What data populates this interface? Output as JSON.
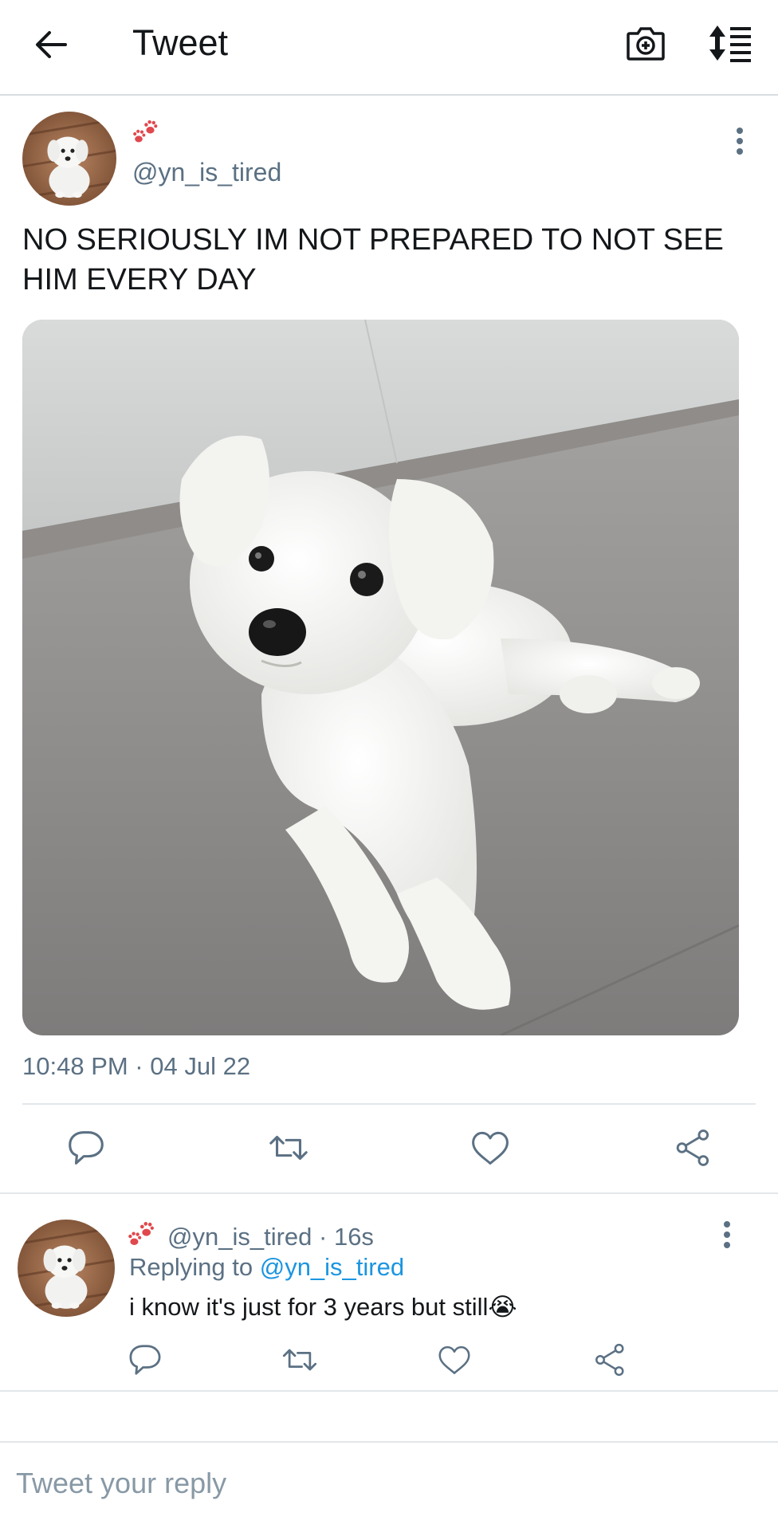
{
  "header": {
    "title": "Tweet",
    "back_icon": "arrow-left-icon",
    "camera_icon": "camera-add-icon",
    "sort_icon": "sort-list-icon"
  },
  "main_tweet": {
    "handle": "@yn_is_tired",
    "text": "NO SERIOUSLY IM NOT PREPARED TO NOT SEE HIM EVERY DAY",
    "timestamp": "10:48 PM · 04 Jul 22",
    "media_icon": "dog-photo",
    "actions": [
      "reply-icon",
      "retweet-icon",
      "like-icon",
      "share-icon"
    ]
  },
  "reply_tweet": {
    "handle": "@yn_is_tired",
    "time": "· 16s",
    "replying_label": "Replying to",
    "replying_handle": "@yn_is_tired",
    "text": "i know it's just for 3 years but still",
    "emoji": "😭",
    "actions": [
      "reply-icon",
      "retweet-icon",
      "like-icon",
      "share-icon"
    ]
  },
  "compose": {
    "placeholder": "Tweet your reply"
  },
  "colors": {
    "text": "#14171a",
    "muted": "#5b7083",
    "link": "#1b95e0",
    "paw": "#e0484d",
    "icon": "#5b7083"
  }
}
